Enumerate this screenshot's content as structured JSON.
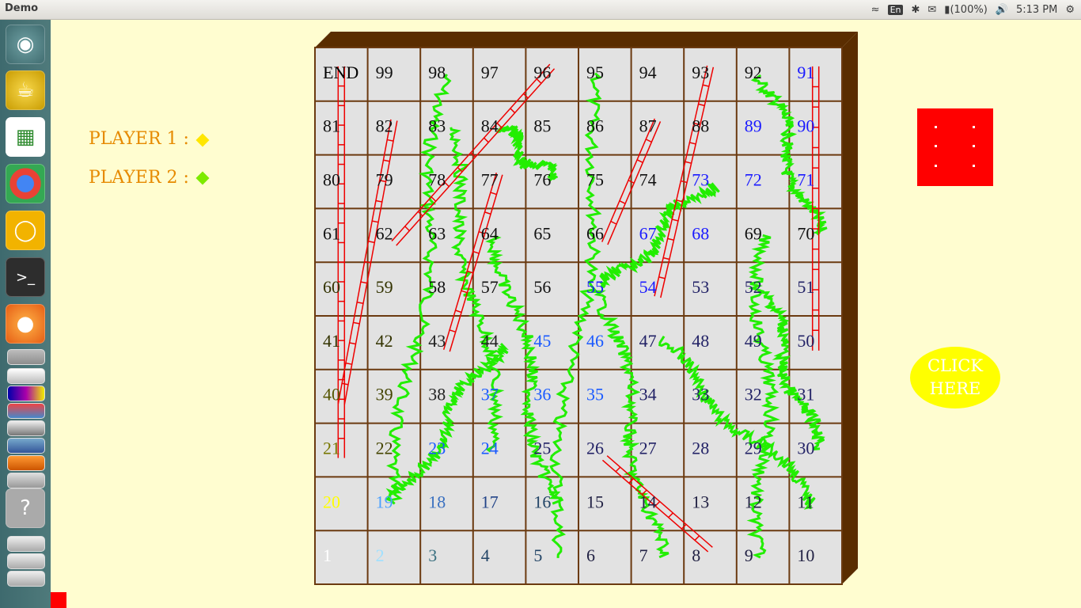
{
  "topbar": {
    "app_title": "Demo",
    "keyboard": "En",
    "battery": "(100%)",
    "time": "5:13 PM"
  },
  "launcher": {
    "items": [
      "ubuntu-dash-icon",
      "teapot-icon",
      "spreadsheet-icon",
      "chrome-icon",
      "lightbulb-icon",
      "terminal-icon",
      "firefox-icon",
      "files-stack-icon",
      "help-icon"
    ]
  },
  "players": [
    {
      "label": "PLAYER 1 :",
      "color": "#ffe600"
    },
    {
      "label": "PLAYER 2 :",
      "color": "#7dea00"
    }
  ],
  "board": {
    "end_label": "END",
    "rows": [
      [
        "END",
        "99",
        "98",
        "97",
        "96",
        "95",
        "94",
        "93",
        "92",
        "91"
      ],
      [
        "81",
        "82",
        "83",
        "84",
        "85",
        "86",
        "87",
        "88",
        "89",
        "90"
      ],
      [
        "80",
        "79",
        "78",
        "77",
        "76",
        "75",
        "74",
        "73",
        "72",
        "71"
      ],
      [
        "61",
        "62",
        "63",
        "64",
        "65",
        "66",
        "67",
        "68",
        "69",
        "70"
      ],
      [
        "60",
        "59",
        "58",
        "57",
        "56",
        "55",
        "54",
        "53",
        "52",
        "51"
      ],
      [
        "41",
        "42",
        "43",
        "44",
        "45",
        "46",
        "47",
        "48",
        "49",
        "50"
      ],
      [
        "40",
        "39",
        "38",
        "37",
        "36",
        "35",
        "34",
        "33",
        "32",
        "31"
      ],
      [
        "21",
        "22",
        "23",
        "24",
        "25",
        "26",
        "27",
        "28",
        "29",
        "30"
      ],
      [
        "20",
        "19",
        "18",
        "17",
        "16",
        "15",
        "14",
        "13",
        "12",
        "11"
      ],
      [
        "1",
        "2",
        "3",
        "4",
        "5",
        "6",
        "7",
        "8",
        "9",
        "10"
      ]
    ],
    "colors": {
      "END": "#000",
      "99": "#111",
      "98": "#111",
      "97": "#111",
      "96": "#111",
      "95": "#111",
      "94": "#111",
      "93": "#111",
      "92": "#111",
      "91": "#1a1aff",
      "81": "#111",
      "82": "#111",
      "83": "#111",
      "84": "#111",
      "85": "#111",
      "86": "#111",
      "87": "#111",
      "88": "#111",
      "89": "#1a1aff",
      "90": "#1a1aff",
      "80": "#111",
      "79": "#111",
      "78": "#111",
      "77": "#111",
      "76": "#111",
      "75": "#111",
      "74": "#111",
      "73": "#1a1aff",
      "72": "#1a1aff",
      "71": "#1a1aff",
      "61": "#111",
      "62": "#111",
      "63": "#111",
      "64": "#111",
      "65": "#111",
      "66": "#111",
      "67": "#1a1aff",
      "68": "#1a1aff",
      "69": "#111",
      "70": "#111",
      "60": "#333300",
      "59": "#333300",
      "58": "#111",
      "57": "#111",
      "56": "#111",
      "55": "#1a1aff",
      "54": "#1a1aff",
      "53": "#222266",
      "52": "#222266",
      "51": "#222266",
      "41": "#333300",
      "42": "#333300",
      "43": "#222",
      "44": "#222",
      "45": "#1a5aff",
      "46": "#1a5aff",
      "47": "#222266",
      "48": "#222266",
      "49": "#222266",
      "50": "#222266",
      "40": "#555500",
      "39": "#444400",
      "38": "#222",
      "37": "#1a5aff",
      "36": "#1a5aff",
      "35": "#1a5aff",
      "34": "#222266",
      "33": "#222266",
      "32": "#222266",
      "31": "#222266",
      "21": "#777700",
      "22": "#444400",
      "23": "#1a5aff",
      "24": "#1a5aff",
      "25": "#222266",
      "26": "#222266",
      "27": "#222266",
      "28": "#222266",
      "29": "#222266",
      "30": "#222266",
      "20": "#ffff00",
      "19": "#4aa0ff",
      "18": "#3a70c0",
      "17": "#224488",
      "16": "#224466",
      "15": "#222244",
      "14": "#222244",
      "13": "#222244",
      "12": "#222244",
      "11": "#222244",
      "1": "#ffffff",
      "2": "#a0e0ff",
      "3": "#3a7080",
      "4": "#224466",
      "5": "#224466",
      "6": "#222244",
      "7": "#222244",
      "8": "#222244",
      "9": "#222244",
      "10": "#222244"
    },
    "ladders": [
      {
        "from": "21",
        "to": "END"
      },
      {
        "from": "43",
        "to": "77"
      },
      {
        "from": "62",
        "to": "96"
      },
      {
        "from": "66",
        "to": "87"
      },
      {
        "from": "54",
        "to": "93"
      },
      {
        "from": "50",
        "to": "91"
      },
      {
        "from": "40",
        "to": "82"
      },
      {
        "from": "26",
        "to": "8"
      }
    ],
    "snakes": [
      {
        "from": "98",
        "to": "19"
      },
      {
        "from": "95",
        "to": "5"
      },
      {
        "from": "92",
        "to": "70"
      },
      {
        "from": "84",
        "to": "76"
      },
      {
        "from": "83",
        "to": "24"
      },
      {
        "from": "73",
        "to": "55"
      },
      {
        "from": "69",
        "to": "9"
      },
      {
        "from": "64",
        "to": "16"
      },
      {
        "from": "55",
        "to": "7"
      },
      {
        "from": "52",
        "to": "30"
      },
      {
        "from": "47",
        "to": "11"
      },
      {
        "from": "44",
        "to": "19"
      }
    ]
  },
  "die": {
    "value": 6,
    "color": "#ff0000"
  },
  "click_button": {
    "line1": "CLICK",
    "line2": "HERE"
  }
}
